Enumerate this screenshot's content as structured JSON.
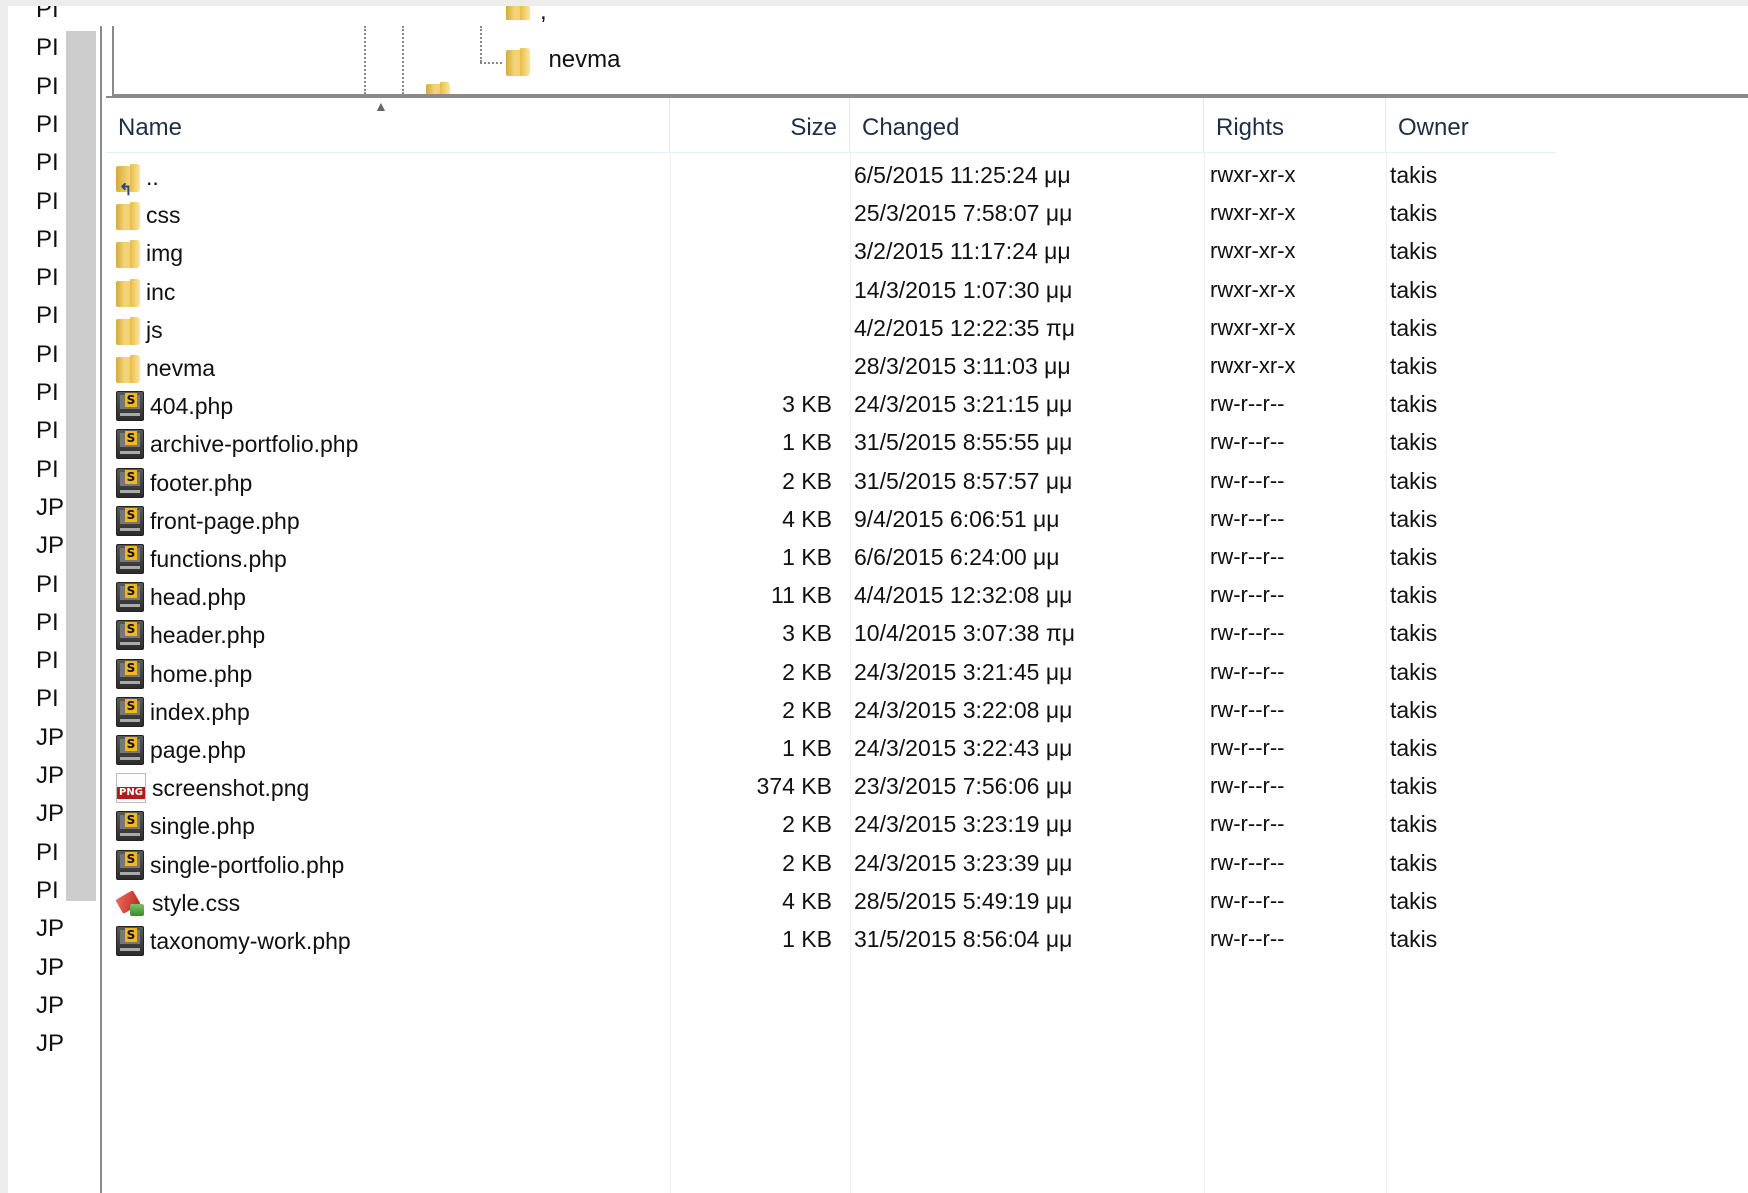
{
  "left_list": {
    "items": [
      "PI",
      "PI",
      "PI",
      "PI",
      "PI",
      "PI",
      "PI",
      "PI",
      "PI",
      "PI",
      "PI",
      "PI",
      "PI",
      "JP",
      "JP",
      "PI",
      "PI",
      "PI",
      "PI",
      "JP",
      "JP",
      "JP",
      "PI",
      "PI",
      "JP",
      "JP",
      "JP",
      "JP"
    ]
  },
  "tree": {
    "items": [
      {
        "label": ","
      },
      {
        "label": "nevma"
      }
    ]
  },
  "columns": {
    "name": "Name",
    "size": "Size",
    "changed": "Changed",
    "rights": "Rights",
    "owner": "Owner"
  },
  "files": [
    {
      "icon": "parent-folder-icon",
      "name": "..",
      "size": "",
      "changed": "6/5/2015 11:25:24 μμ",
      "rights": "rwxr-xr-x",
      "owner": "takis"
    },
    {
      "icon": "folder-icon",
      "name": "css",
      "size": "",
      "changed": "25/3/2015 7:58:07 μμ",
      "rights": "rwxr-xr-x",
      "owner": "takis"
    },
    {
      "icon": "folder-icon",
      "name": "img",
      "size": "",
      "changed": "3/2/2015 11:17:24 μμ",
      "rights": "rwxr-xr-x",
      "owner": "takis"
    },
    {
      "icon": "folder-icon",
      "name": "inc",
      "size": "",
      "changed": "14/3/2015 1:07:30 μμ",
      "rights": "rwxr-xr-x",
      "owner": "takis"
    },
    {
      "icon": "folder-icon",
      "name": "js",
      "size": "",
      "changed": "4/2/2015 12:22:35 πμ",
      "rights": "rwxr-xr-x",
      "owner": "takis"
    },
    {
      "icon": "folder-icon",
      "name": "nevma",
      "size": "",
      "changed": "28/3/2015 3:11:03 μμ",
      "rights": "rwxr-xr-x",
      "owner": "takis"
    },
    {
      "icon": "php-file-icon",
      "name": "404.php",
      "size": "3 KB",
      "changed": "24/3/2015 3:21:15 μμ",
      "rights": "rw-r--r--",
      "owner": "takis"
    },
    {
      "icon": "php-file-icon",
      "name": "archive-portfolio.php",
      "size": "1 KB",
      "changed": "31/5/2015 8:55:55 μμ",
      "rights": "rw-r--r--",
      "owner": "takis"
    },
    {
      "icon": "php-file-icon",
      "name": "footer.php",
      "size": "2 KB",
      "changed": "31/5/2015 8:57:57 μμ",
      "rights": "rw-r--r--",
      "owner": "takis"
    },
    {
      "icon": "php-file-icon",
      "name": "front-page.php",
      "size": "4 KB",
      "changed": "9/4/2015 6:06:51 μμ",
      "rights": "rw-r--r--",
      "owner": "takis"
    },
    {
      "icon": "php-file-icon",
      "name": "functions.php",
      "size": "1 KB",
      "changed": "6/6/2015 6:24:00 μμ",
      "rights": "rw-r--r--",
      "owner": "takis"
    },
    {
      "icon": "php-file-icon",
      "name": "head.php",
      "size": "11 KB",
      "changed": "4/4/2015 12:32:08 μμ",
      "rights": "rw-r--r--",
      "owner": "takis"
    },
    {
      "icon": "php-file-icon",
      "name": "header.php",
      "size": "3 KB",
      "changed": "10/4/2015 3:07:38 πμ",
      "rights": "rw-r--r--",
      "owner": "takis"
    },
    {
      "icon": "php-file-icon",
      "name": "home.php",
      "size": "2 KB",
      "changed": "24/3/2015 3:21:45 μμ",
      "rights": "rw-r--r--",
      "owner": "takis"
    },
    {
      "icon": "php-file-icon",
      "name": "index.php",
      "size": "2 KB",
      "changed": "24/3/2015 3:22:08 μμ",
      "rights": "rw-r--r--",
      "owner": "takis"
    },
    {
      "icon": "php-file-icon",
      "name": "page.php",
      "size": "1 KB",
      "changed": "24/3/2015 3:22:43 μμ",
      "rights": "rw-r--r--",
      "owner": "takis"
    },
    {
      "icon": "png-file-icon",
      "name": "screenshot.png",
      "size": "374 KB",
      "changed": "23/3/2015 7:56:06 μμ",
      "rights": "rw-r--r--",
      "owner": "takis"
    },
    {
      "icon": "php-file-icon",
      "name": "single.php",
      "size": "2 KB",
      "changed": "24/3/2015 3:23:19 μμ",
      "rights": "rw-r--r--",
      "owner": "takis"
    },
    {
      "icon": "php-file-icon",
      "name": "single-portfolio.php",
      "size": "2 KB",
      "changed": "24/3/2015 3:23:39 μμ",
      "rights": "rw-r--r--",
      "owner": "takis"
    },
    {
      "icon": "css-file-icon",
      "name": "style.css",
      "size": "4 KB",
      "changed": "28/5/2015 5:49:19 μμ",
      "rights": "rw-r--r--",
      "owner": "takis"
    },
    {
      "icon": "php-file-icon",
      "name": "taxonomy-work.php",
      "size": "1 KB",
      "changed": "31/5/2015 8:56:04 μμ",
      "rights": "rw-r--r--",
      "owner": "takis"
    }
  ]
}
